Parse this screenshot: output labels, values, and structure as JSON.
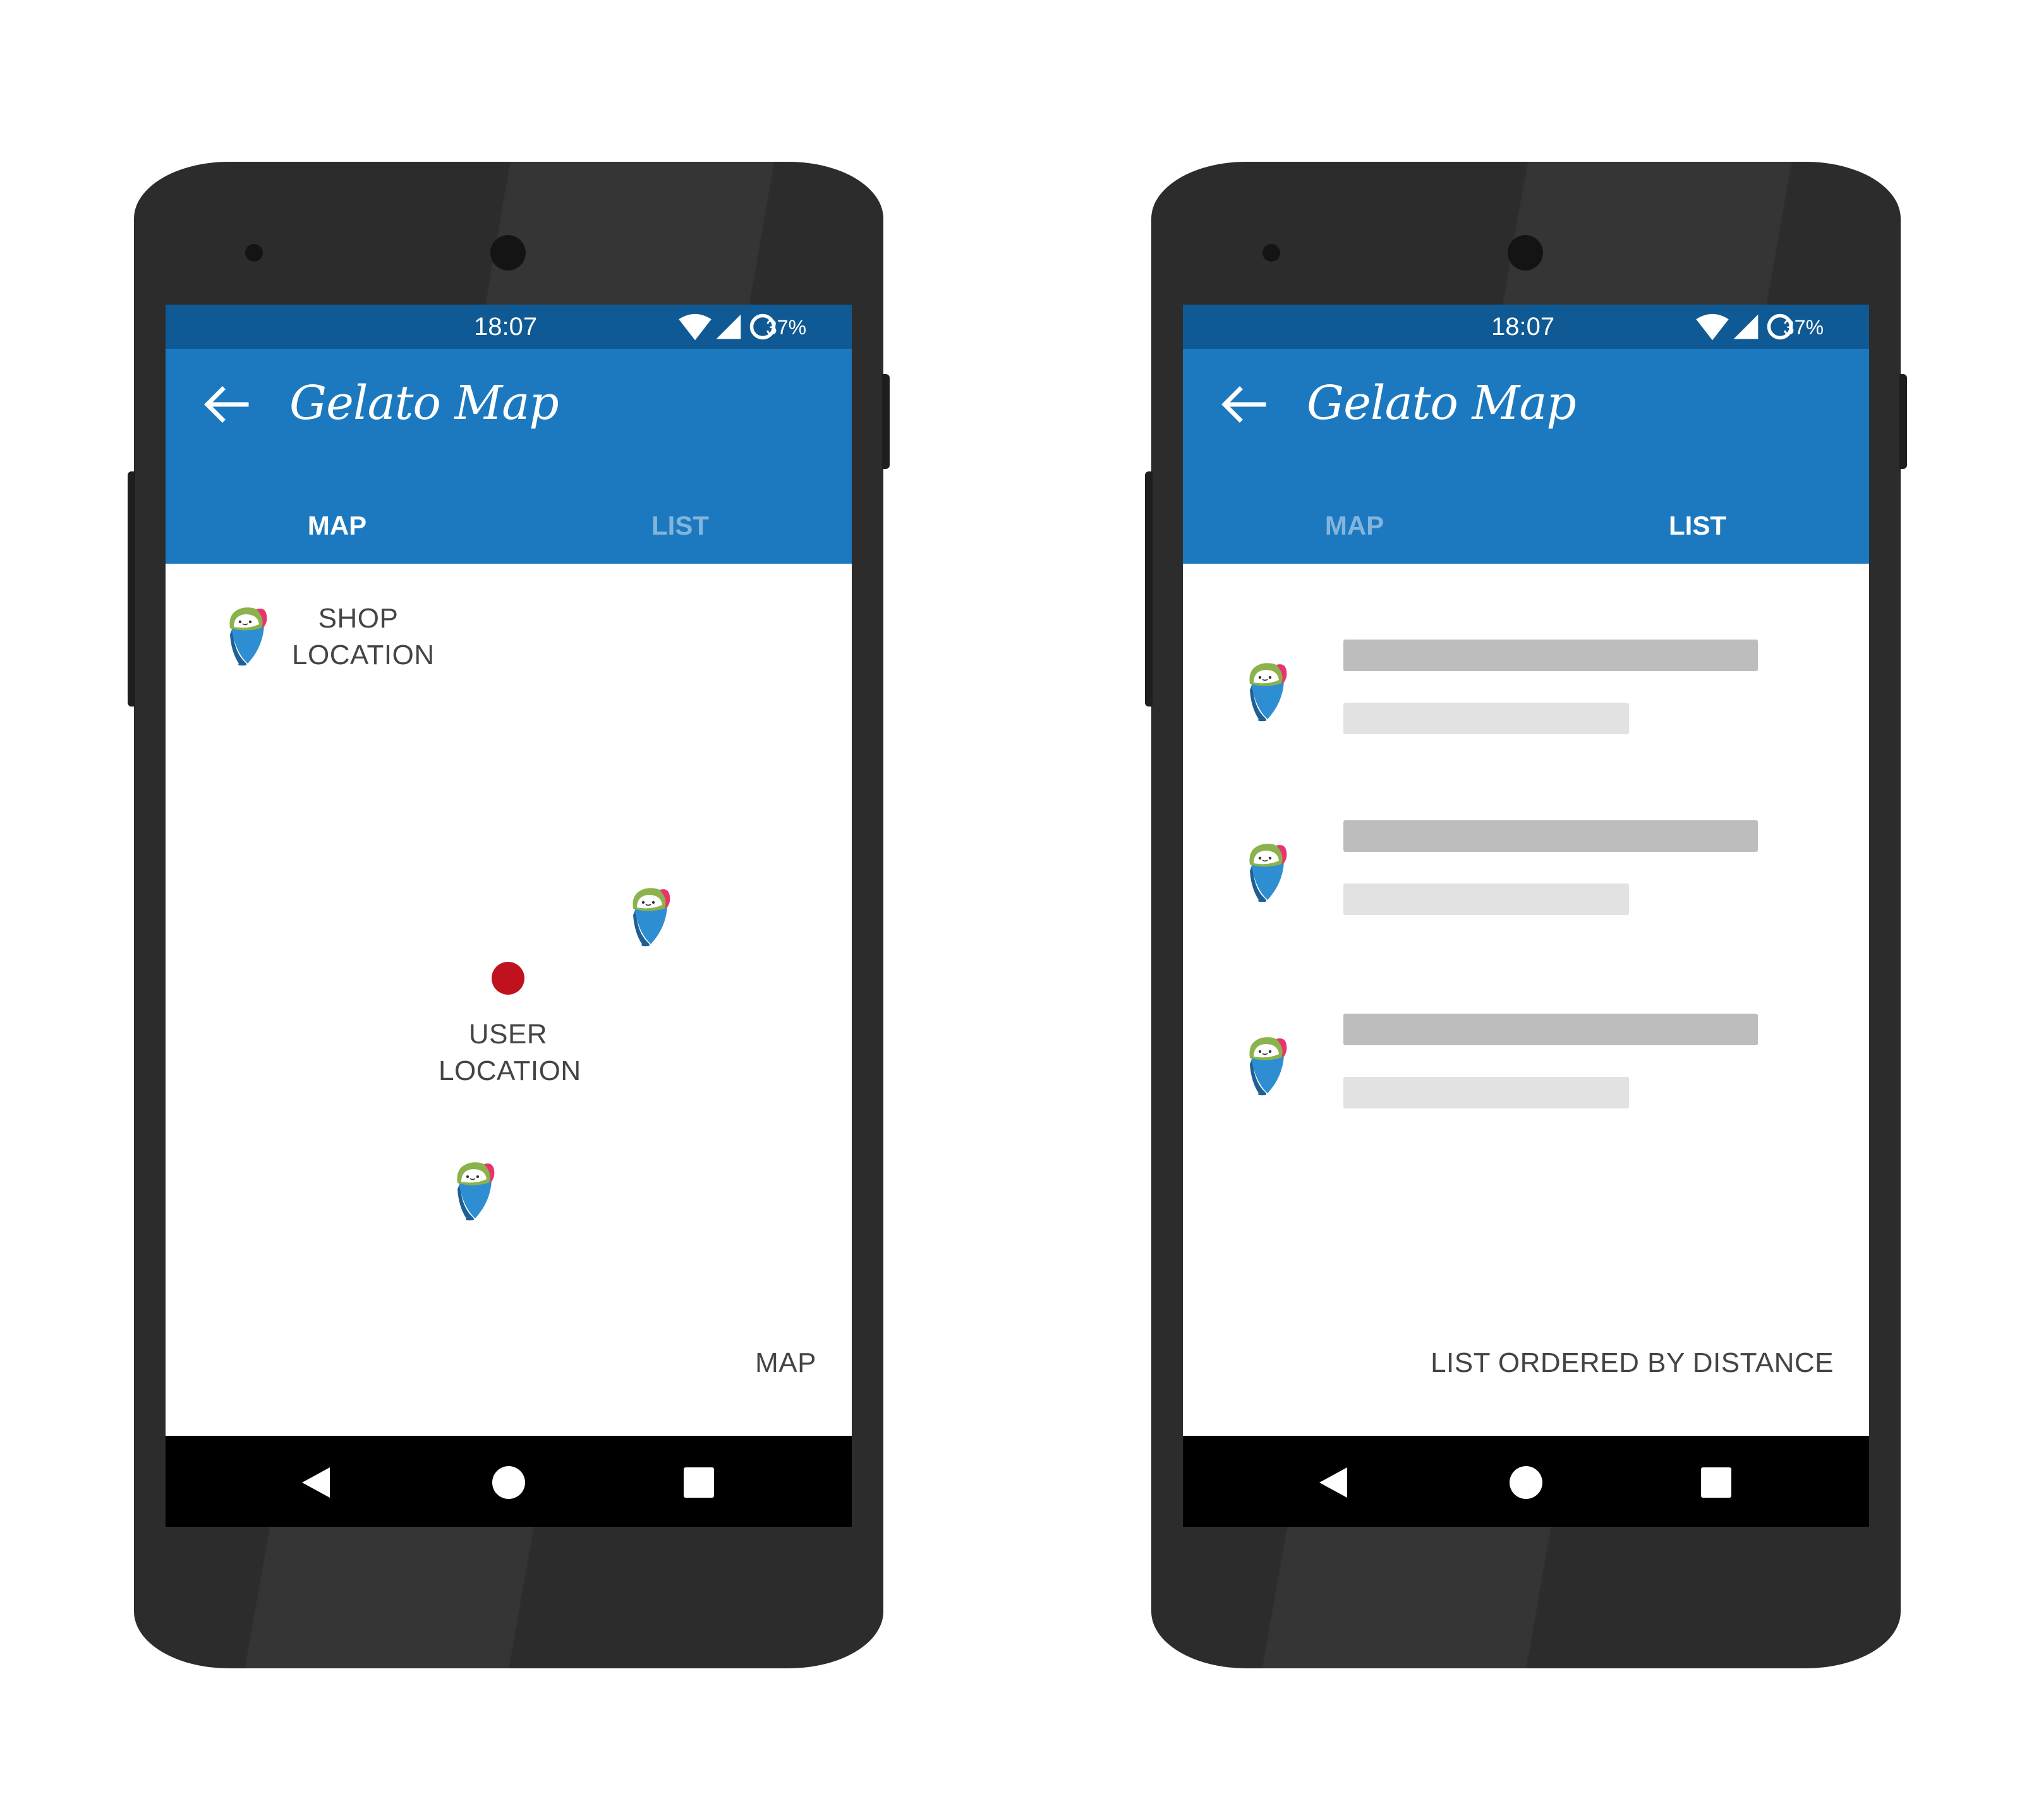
{
  "colors": {
    "status_bar": "#0f5a94",
    "app_bar": "#1c79bf",
    "user_dot": "#c0121e",
    "phone_body": "#2c2c2c"
  },
  "phones": [
    {
      "status": {
        "time": "18:07",
        "battery": "37%"
      },
      "app_title": "Gelato Map",
      "tabs": {
        "map": "MAP",
        "list": "LIST",
        "active": "map"
      },
      "map": {
        "shop_label_line1": "SHOP",
        "shop_label_line2": "LOCATION",
        "user_label_line1": "USER",
        "user_label_line2": "LOCATION",
        "caption": "MAP"
      }
    },
    {
      "status": {
        "time": "18:07",
        "battery": "37%"
      },
      "app_title": "Gelato Map",
      "tabs": {
        "map": "MAP",
        "list": "LIST",
        "active": "list"
      },
      "list": {
        "caption": "LIST ORDERED BY DISTANCE"
      }
    }
  ],
  "icons": {
    "back": "arrow-left-icon",
    "wifi": "wifi-icon",
    "signal": "cell-signal-icon",
    "ring": "circle-status-icon",
    "marker": "gelato-marker-icon",
    "nav_back": "nav-back-icon",
    "nav_home": "nav-home-icon",
    "nav_recent": "nav-recent-icon"
  }
}
